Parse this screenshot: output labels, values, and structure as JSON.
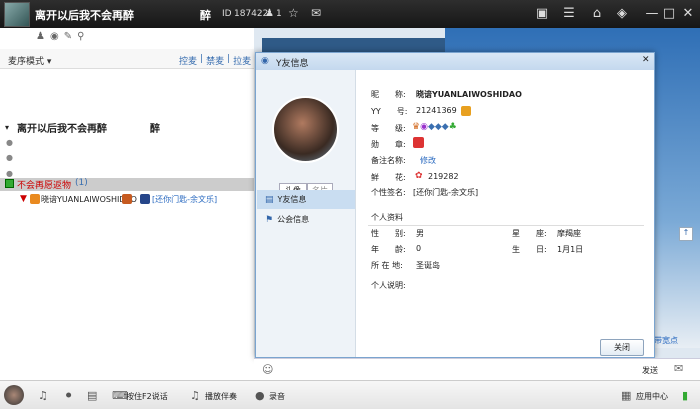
{
  "titlebar": {
    "room_name": "离开以后我不会再醉",
    "room_sub": "醉",
    "id_label": "ID",
    "room_id": "187422",
    "user_count": "1"
  },
  "left": {
    "sort_label": "麦序模式",
    "sort_actions": [
      "控麦",
      "禁麦",
      "拉麦"
    ],
    "group_title": "离开以后我不会再醉",
    "group_sub": "醉",
    "section_title": "不会再愿返物",
    "section_count": "(1)",
    "member_name": "晓谙YUANLAIWOSHIDAO",
    "member_song": "[还你门匙-余文乐]"
  },
  "dialog": {
    "title": "Y友信息",
    "btn_avatar": "头像",
    "btn_card": "名片",
    "nav": [
      "Y友信息",
      "公会信息"
    ],
    "nick_label": "昵　　称:",
    "nick": "晓谙YUANLAIWOSHIDAO",
    "yy_label": "YY　　号:",
    "yy": "21241369",
    "level_label": "等　　级:",
    "medal_label": "勋　　章:",
    "remark_label": "备注名称:",
    "remark": "修改",
    "flower_label": "鲜　　花:",
    "flower": "219282",
    "sign_label": "个性签名:",
    "sign": "[还你门匙-余文乐]",
    "personal_title": "个人资料",
    "gender_label": "性　　别:",
    "gender": "男",
    "star_label": "星　　座:",
    "star": "摩羯座",
    "age_label": "年　　龄:",
    "age": "0",
    "birth_label": "生　　日:",
    "birth": "1月1日",
    "loc_label": "所 在 地:",
    "loc": "圣诞岛",
    "desc_label": "个人说明:",
    "close": "关闭"
  },
  "chat": {
    "send": "发送"
  },
  "bottom": {
    "hotkey": "按住F2说话",
    "accompany": "播放伴奏",
    "record": "录音",
    "app_center": "应用中心"
  },
  "side_text": "带宽点"
}
